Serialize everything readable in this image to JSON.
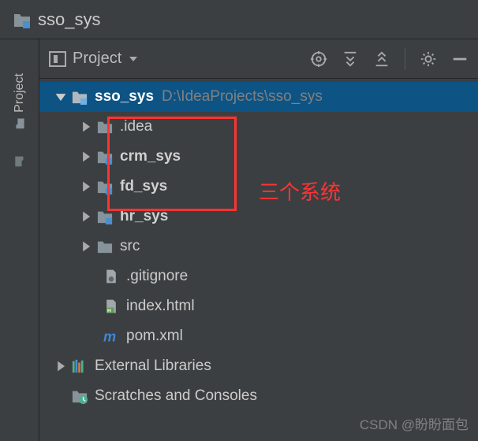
{
  "header": {
    "title": "sso_sys"
  },
  "sidebar": {
    "tab_label": "Project"
  },
  "toolbar": {
    "project_label": "Project"
  },
  "tree": {
    "root": {
      "name": "sso_sys",
      "path": "D:\\IdeaProjects\\sso_sys"
    },
    "children": [
      {
        "name": ".idea"
      },
      {
        "name": "crm_sys"
      },
      {
        "name": "fd_sys"
      },
      {
        "name": "hr_sys"
      },
      {
        "name": "src"
      },
      {
        "name": ".gitignore"
      },
      {
        "name": "index.html"
      },
      {
        "name": "pom.xml"
      }
    ],
    "external": "External Libraries",
    "scratches": "Scratches and Consoles"
  },
  "annotation": {
    "text": "三个系统"
  },
  "watermark": "CSDN @盼盼面包"
}
